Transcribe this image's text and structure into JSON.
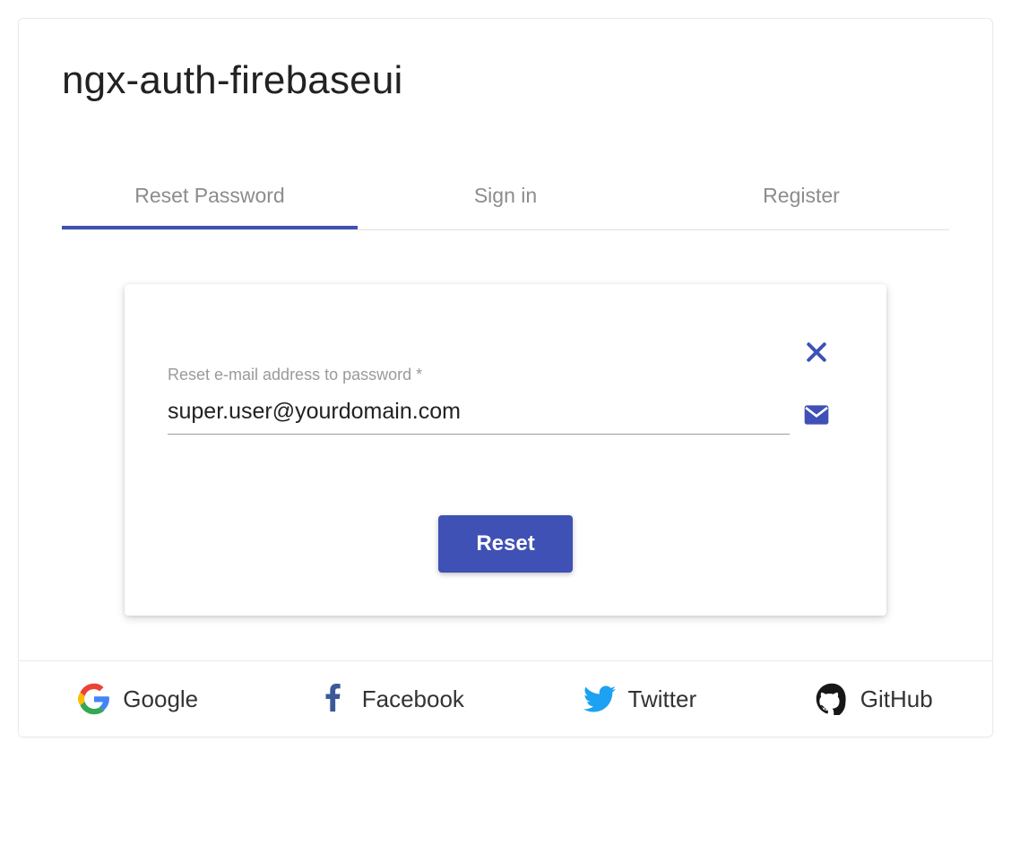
{
  "title": "ngx-auth-firebaseui",
  "tabs": {
    "reset": "Reset Password",
    "signin": "Sign in",
    "register": "Register"
  },
  "form": {
    "emailLabel": "Reset e-mail address to password *",
    "emailValue": "super.user@yourdomain.com",
    "resetButton": "Reset"
  },
  "providers": {
    "google": "Google",
    "facebook": "Facebook",
    "twitter": "Twitter",
    "github": "GitHub"
  },
  "colors": {
    "accent": "#3f51b5"
  }
}
